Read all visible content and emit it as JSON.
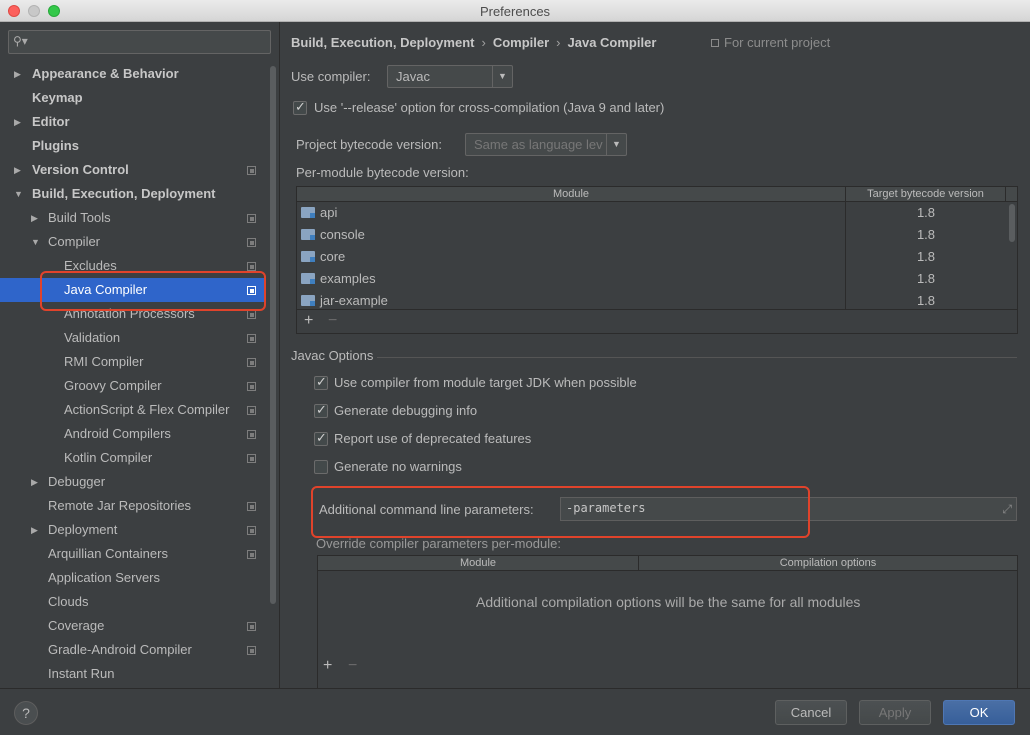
{
  "window": {
    "title": "Preferences"
  },
  "sidebar": {
    "search_placeholder": "",
    "items": [
      {
        "label": "Appearance & Behavior",
        "level": 0,
        "arrow": "▶",
        "bold": true,
        "proj": false
      },
      {
        "label": "Keymap",
        "level": 0,
        "arrow": "",
        "bold": true,
        "proj": false
      },
      {
        "label": "Editor",
        "level": 0,
        "arrow": "▶",
        "bold": true,
        "proj": false
      },
      {
        "label": "Plugins",
        "level": 0,
        "arrow": "",
        "bold": true,
        "proj": false
      },
      {
        "label": "Version Control",
        "level": 0,
        "arrow": "▶",
        "bold": true,
        "proj": true
      },
      {
        "label": "Build, Execution, Deployment",
        "level": 0,
        "arrow": "▼",
        "bold": true,
        "proj": false
      },
      {
        "label": "Build Tools",
        "level": 1,
        "arrow": "▶",
        "bold": false,
        "proj": true
      },
      {
        "label": "Compiler",
        "level": 1,
        "arrow": "▼",
        "bold": false,
        "proj": true
      },
      {
        "label": "Excludes",
        "level": 2,
        "arrow": "",
        "bold": false,
        "proj": true
      },
      {
        "label": "Java Compiler",
        "level": 2,
        "arrow": "",
        "bold": false,
        "proj": true
      },
      {
        "label": "Annotation Processors",
        "level": 2,
        "arrow": "",
        "bold": false,
        "proj": true
      },
      {
        "label": "Validation",
        "level": 2,
        "arrow": "",
        "bold": false,
        "proj": true
      },
      {
        "label": "RMI Compiler",
        "level": 2,
        "arrow": "",
        "bold": false,
        "proj": true
      },
      {
        "label": "Groovy Compiler",
        "level": 2,
        "arrow": "",
        "bold": false,
        "proj": true
      },
      {
        "label": "ActionScript & Flex Compiler",
        "level": 2,
        "arrow": "",
        "bold": false,
        "proj": true
      },
      {
        "label": "Android Compilers",
        "level": 2,
        "arrow": "",
        "bold": false,
        "proj": true
      },
      {
        "label": "Kotlin Compiler",
        "level": 2,
        "arrow": "",
        "bold": false,
        "proj": true
      },
      {
        "label": "Debugger",
        "level": 1,
        "arrow": "▶",
        "bold": false,
        "proj": false
      },
      {
        "label": "Remote Jar Repositories",
        "level": 1,
        "arrow": "",
        "bold": false,
        "proj": true
      },
      {
        "label": "Deployment",
        "level": 1,
        "arrow": "▶",
        "bold": false,
        "proj": true
      },
      {
        "label": "Arquillian Containers",
        "level": 1,
        "arrow": "",
        "bold": false,
        "proj": true
      },
      {
        "label": "Application Servers",
        "level": 1,
        "arrow": "",
        "bold": false,
        "proj": false
      },
      {
        "label": "Clouds",
        "level": 1,
        "arrow": "",
        "bold": false,
        "proj": false
      },
      {
        "label": "Coverage",
        "level": 1,
        "arrow": "",
        "bold": false,
        "proj": true
      },
      {
        "label": "Gradle-Android Compiler",
        "level": 1,
        "arrow": "",
        "bold": false,
        "proj": true
      },
      {
        "label": "Instant Run",
        "level": 1,
        "arrow": "",
        "bold": false,
        "proj": false
      }
    ],
    "selected_label": "Java Compiler"
  },
  "main": {
    "breadcrumb": [
      "Build, Execution, Deployment",
      "Compiler",
      "Java Compiler"
    ],
    "breadcrumb_sep": "›",
    "scope_label": "For current project",
    "use_compiler_label": "Use compiler:",
    "use_compiler_value": "Javac",
    "release_option_label": "Use '--release' option for cross-compilation (Java 9 and later)",
    "release_option_checked": true,
    "project_bytecode_label": "Project bytecode version:",
    "project_bytecode_value": "Same as language lev",
    "per_module_label": "Per-module bytecode version:",
    "module_table": {
      "headers": [
        "Module",
        "Target bytecode version"
      ],
      "rows": [
        {
          "module": "api",
          "version": "1.8"
        },
        {
          "module": "console",
          "version": "1.8"
        },
        {
          "module": "core",
          "version": "1.8"
        },
        {
          "module": "examples",
          "version": "1.8"
        },
        {
          "module": "jar-example",
          "version": "1.8"
        }
      ],
      "add": "+",
      "remove": "−"
    },
    "javac_section_title": "Javac Options",
    "javac_options": [
      {
        "label": "Use compiler from module target JDK when possible",
        "checked": true
      },
      {
        "label": "Generate debugging info",
        "checked": true
      },
      {
        "label": "Report use of deprecated features",
        "checked": true
      },
      {
        "label": "Generate no warnings",
        "checked": false
      }
    ],
    "additional_params_label": "Additional command line parameters:",
    "additional_params_value": "-parameters",
    "override_label": "Override compiler parameters per-module:",
    "override_table": {
      "headers": [
        "Module",
        "Compilation options"
      ],
      "empty_text": "Additional compilation options will be the same for all modules",
      "add": "+",
      "remove": "−"
    }
  },
  "footer": {
    "help": "?",
    "cancel": "Cancel",
    "apply": "Apply",
    "ok": "OK"
  },
  "colors": {
    "selection": "#2f65ca",
    "highlight_box": "#e0432b",
    "primary_button": "#375f9a"
  }
}
